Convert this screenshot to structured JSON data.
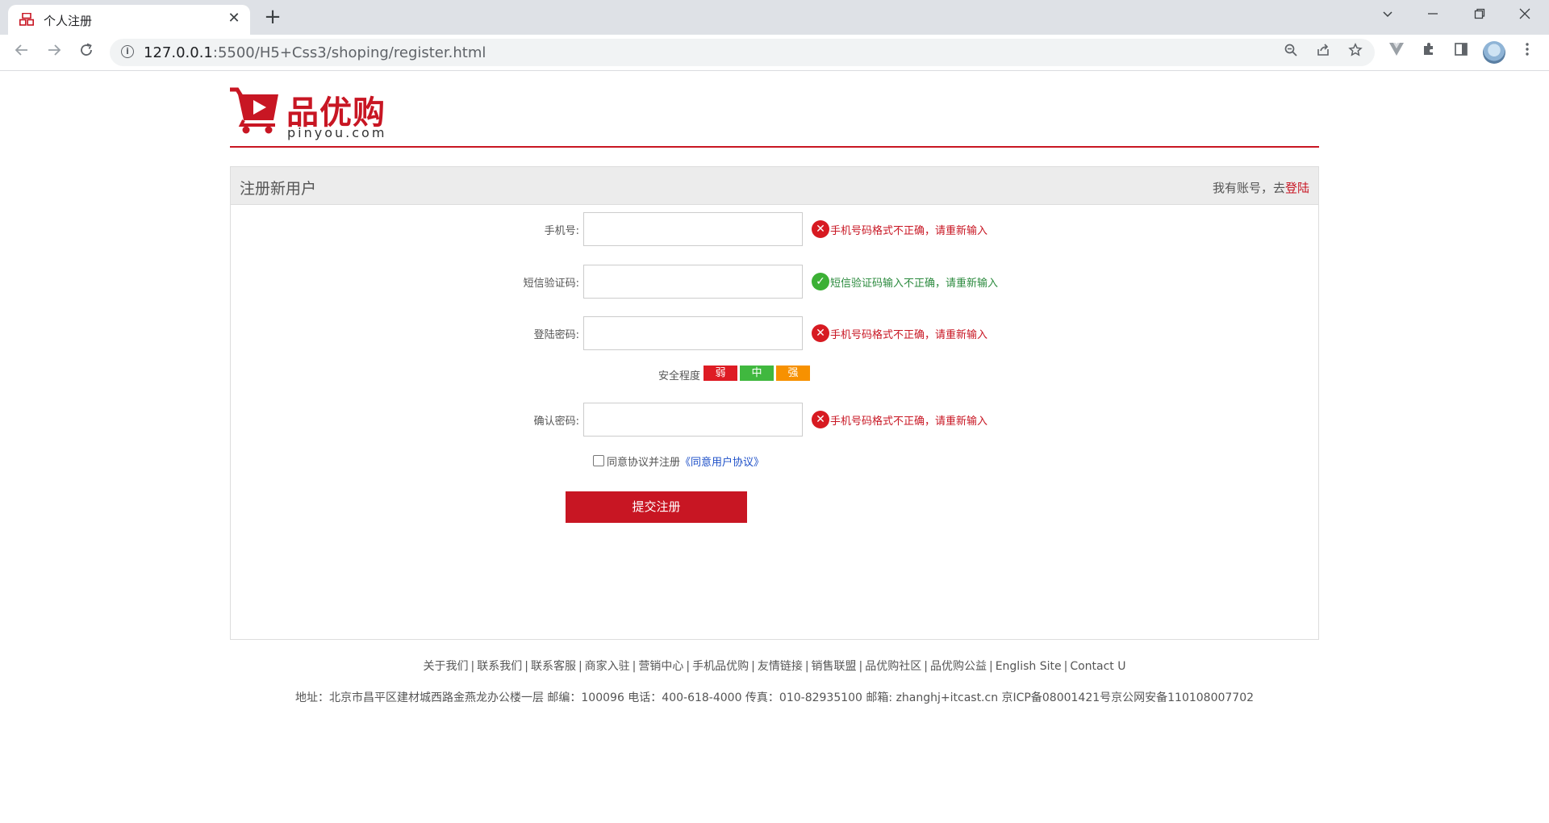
{
  "browser": {
    "tab_title": "个人注册",
    "url_host": "127.0.0.1",
    "url_path": ":5500/H5+Css3/shoping/register.html",
    "new_tab_symbol": "+",
    "close_symbol": "✕",
    "colors": {
      "tabstrip": "#dee1e6",
      "omnibox": "#f1f3f4"
    }
  },
  "logo": {
    "cn": "品优购",
    "en": "pinyou.com"
  },
  "register": {
    "title": "注册新用户",
    "login_prompt": "我有账号，去",
    "login_link": "登陆",
    "fields": [
      {
        "label": "手机号:",
        "value": "",
        "message": "手机号码格式不正确，请重新输入",
        "status": "error"
      },
      {
        "label": "短信验证码:",
        "value": "",
        "message": "短信验证码输入不正确，请重新输入",
        "status": "ok"
      },
      {
        "label": "登陆密码:",
        "value": "",
        "message": "手机号码格式不正确，请重新输入",
        "status": "error"
      },
      {
        "label": "确认密码:",
        "value": "",
        "message": "手机号码格式不正确，请重新输入",
        "status": "error"
      }
    ],
    "strength": {
      "label": "安全程度",
      "levels": [
        {
          "text": "弱",
          "color": "#de1c24"
        },
        {
          "text": "中",
          "color": "#40b83f"
        },
        {
          "text": "强",
          "color": "#f79100"
        }
      ]
    },
    "agree_text": "同意协议并注册",
    "agree_link": "《同意用户协议》",
    "agree_checked": false,
    "submit_label": "提交注册"
  },
  "footer": {
    "links": [
      "关于我们",
      "联系我们",
      "联系客服",
      "商家入驻",
      "营销中心",
      "手机品优购",
      "友情链接",
      "销售联盟",
      "品优购社区",
      "品优购公益",
      "English Site",
      "Contact U"
    ],
    "address": "地址：北京市昌平区建材城西路金燕龙办公楼一层 邮编：100096 电话：400-618-4000 传真：010-82935100 邮箱: zhanghj+itcast.cn 京ICP备08001421号京公网安备110108007702"
  },
  "colors": {
    "brand": "#c81623",
    "error": "#c81623",
    "ok": "#2b8a3e",
    "link": "#1e50c8"
  }
}
